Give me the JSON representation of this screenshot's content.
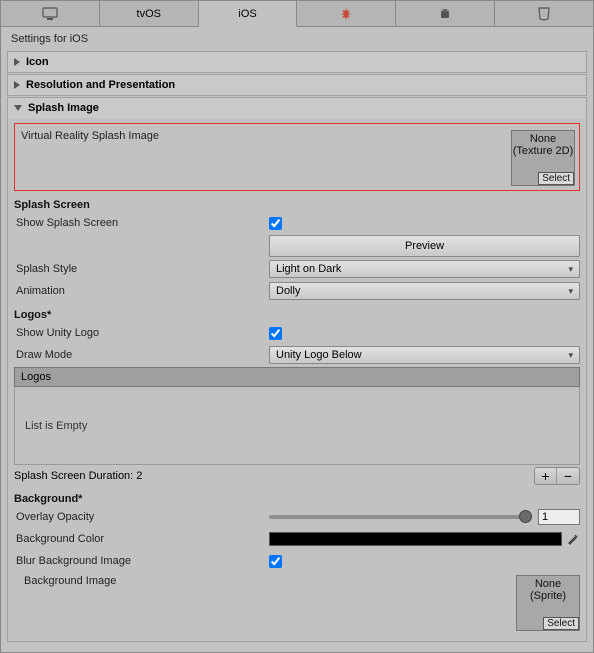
{
  "tabs": {
    "pc_label": "",
    "tvos_label": "tvOS",
    "ios_label": "iOS",
    "firetv_label": "",
    "android_label": "",
    "webgl_label": ""
  },
  "settings_title": "Settings for iOS",
  "foldouts": {
    "icon": "Icon",
    "resolution": "Resolution and Presentation",
    "splash": "Splash Image"
  },
  "splash": {
    "vr_label": "Virtual Reality Splash Image",
    "vr_obj_line1": "None",
    "vr_obj_line2": "(Texture 2D)",
    "select": "Select",
    "screen_hdr": "Splash Screen",
    "show_label": "Show Splash Screen",
    "preview_btn": "Preview",
    "style_label": "Splash Style",
    "style_value": "Light on Dark",
    "anim_label": "Animation",
    "anim_value": "Dolly",
    "logos_hdr": "Logos*",
    "show_unity_label": "Show Unity Logo",
    "draw_mode_label": "Draw Mode",
    "draw_mode_value": "Unity Logo Below",
    "logos_list_hdr": "Logos",
    "logos_empty": "List is Empty",
    "duration_label": "Splash Screen Duration: 2",
    "bg_hdr": "Background*",
    "overlay_label": "Overlay Opacity",
    "overlay_value": "1",
    "bgcolor_label": "Background Color",
    "blur_label": "Blur Background Image",
    "bgimage_label": "Background Image",
    "bgimage_obj_line1": "None",
    "bgimage_obj_line2": "(Sprite)"
  }
}
